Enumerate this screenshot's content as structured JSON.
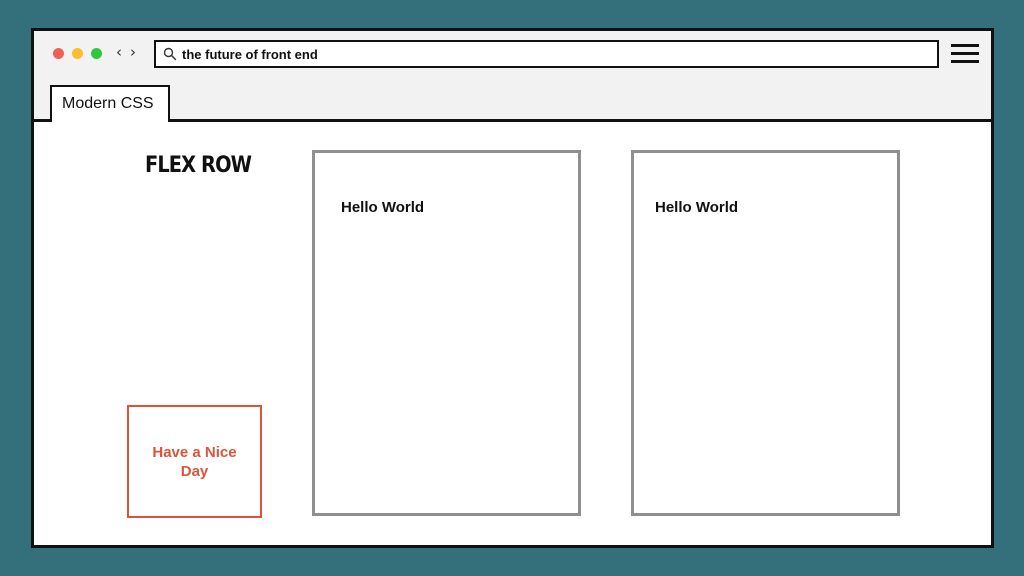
{
  "browser": {
    "address": "the future of front end",
    "tab_label": "Modern CSS",
    "icons": {
      "back": "chevron-left-icon",
      "forward": "chevron-right-icon",
      "search": "search-icon",
      "menu": "hamburger-menu-icon"
    },
    "traffic_light_colors": [
      "#f25f58",
      "#fbbe2e",
      "#2ec83f"
    ]
  },
  "page": {
    "title": "FLEX ROW",
    "nice_day_text": "Have a Nice Day",
    "cards": [
      {
        "text": "Hello World"
      },
      {
        "text": "Hello World"
      }
    ]
  },
  "colors": {
    "background": "#346f7c",
    "accent": "#d9553a",
    "card_border": "#8f8f8f"
  }
}
